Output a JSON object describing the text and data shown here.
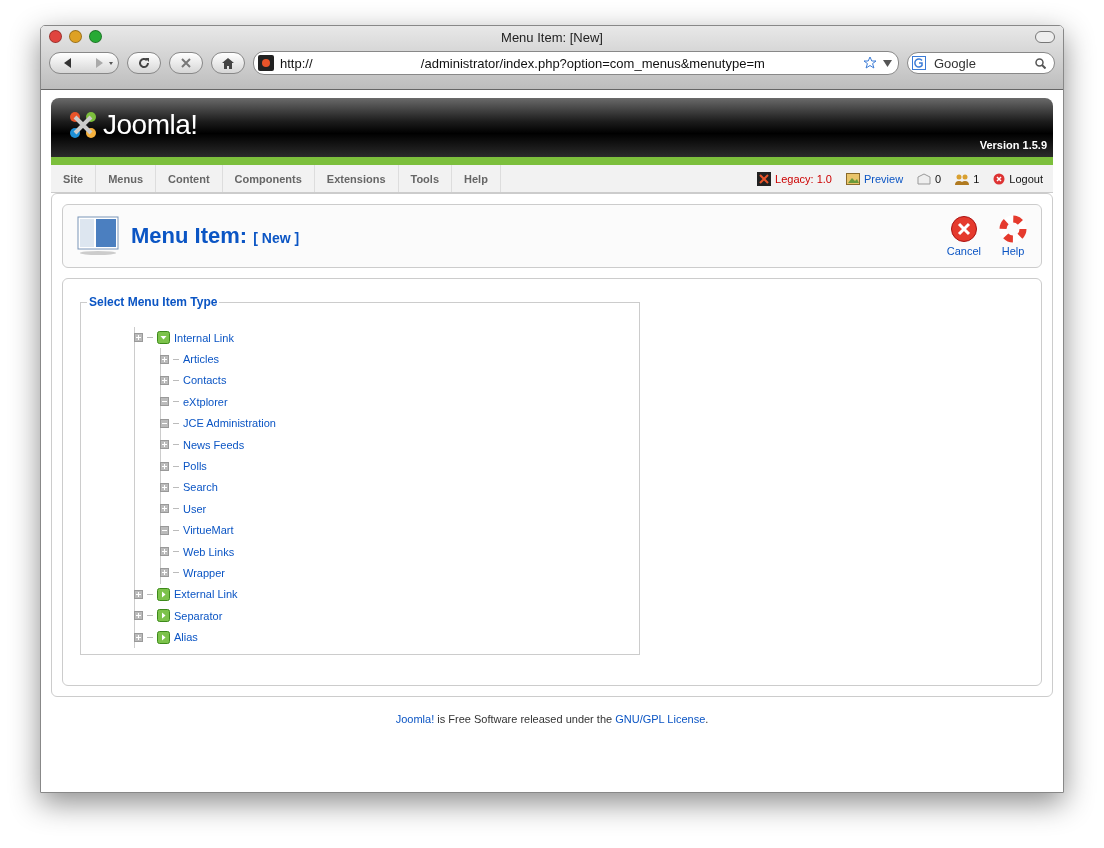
{
  "window": {
    "title": "Menu Item: [New]"
  },
  "browser": {
    "address": "http://                              /administrator/index.php?option=com_menus&menutype=m",
    "search_placeholder": "Google"
  },
  "header": {
    "logo": "Joomla!",
    "version": "Version 1.5.9"
  },
  "menu": [
    {
      "label": "Site"
    },
    {
      "label": "Menus"
    },
    {
      "label": "Content"
    },
    {
      "label": "Components"
    },
    {
      "label": "Extensions"
    },
    {
      "label": "Tools"
    },
    {
      "label": "Help"
    }
  ],
  "status": {
    "legacy": "Legacy: 1.0",
    "preview": "Preview",
    "messages": "0",
    "users": "1",
    "logout": "Logout"
  },
  "toolbar": {
    "title": "Menu Item:",
    "subtitle": "[ New ]",
    "buttons": [
      {
        "kind": "cancel",
        "label": "Cancel"
      },
      {
        "kind": "help",
        "label": "Help"
      }
    ]
  },
  "panel": {
    "legend": "Select Menu Item Type",
    "tree": [
      {
        "label": "Internal Link",
        "expanded": true,
        "children": [
          {
            "label": "Articles",
            "expanded": false
          },
          {
            "label": "Contacts",
            "expanded": false
          },
          {
            "label": "eXtplorer",
            "expanded": true
          },
          {
            "label": "JCE Administration",
            "expanded": true
          },
          {
            "label": "News Feeds",
            "expanded": false
          },
          {
            "label": "Polls",
            "expanded": false
          },
          {
            "label": "Search",
            "expanded": false
          },
          {
            "label": "User",
            "expanded": false
          },
          {
            "label": "VirtueMart",
            "expanded": true
          },
          {
            "label": "Web Links",
            "expanded": false
          },
          {
            "label": "Wrapper",
            "expanded": false
          }
        ]
      },
      {
        "label": "External Link",
        "expanded": false
      },
      {
        "label": "Separator",
        "expanded": false
      },
      {
        "label": "Alias",
        "expanded": false
      }
    ]
  },
  "footer": {
    "parts": [
      {
        "kind": "link",
        "text": "Joomla!"
      },
      {
        "kind": "text",
        "text": " is Free Software released under the "
      },
      {
        "kind": "link",
        "text": "GNU/GPL License"
      },
      {
        "kind": "text",
        "text": "."
      }
    ]
  }
}
